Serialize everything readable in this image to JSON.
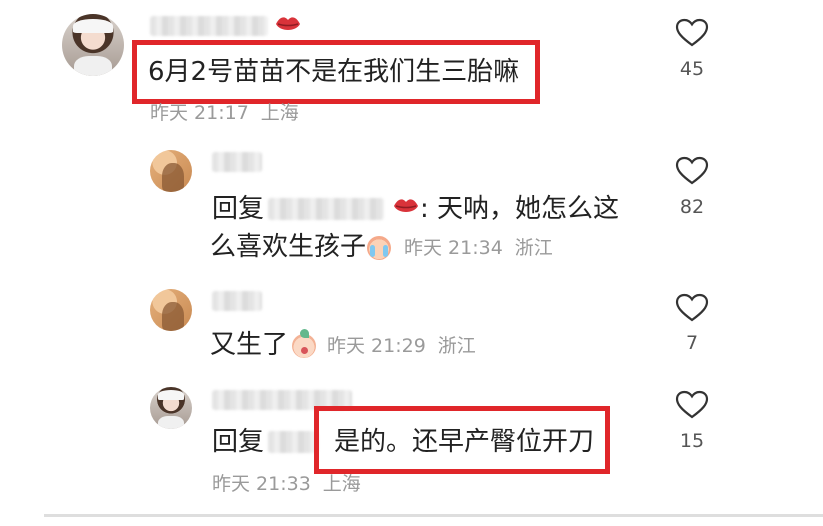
{
  "comments": [
    {
      "text": "6月2号苗苗不是在我们生三胎嘛",
      "meta": {
        "time": "昨天 21:17",
        "location": "上海"
      },
      "likes": "45"
    },
    {
      "reply_prefix": "回复",
      "text_line1": ": 天呐，她怎么这",
      "text_line2": "么喜欢生孩子",
      "meta": {
        "time": "昨天 21:34",
        "location": "浙江"
      },
      "likes": "82"
    },
    {
      "text": "又生了",
      "meta": {
        "time": "昨天 21:29",
        "location": "浙江"
      },
      "likes": "7"
    },
    {
      "reply_prefix": "回复",
      "text": "是的。还早产臀位开刀",
      "meta": {
        "time": "昨天 21:33",
        "location": "上海"
      },
      "likes": "15"
    }
  ],
  "colors": {
    "highlight": "#e0262a",
    "meta": "#9a9a9a",
    "text": "#222222"
  },
  "icons": [
    "heart-icon",
    "lips-emoji",
    "crying-emoji",
    "face-emoji"
  ]
}
